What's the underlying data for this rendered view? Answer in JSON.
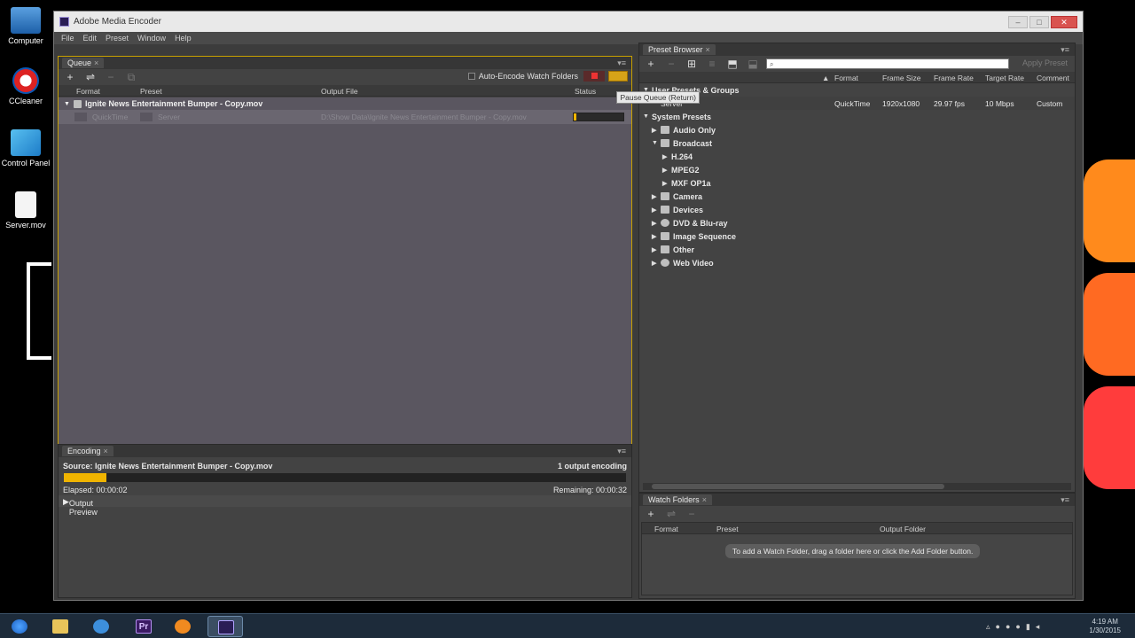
{
  "desktop": {
    "icons": [
      {
        "label": "Computer"
      },
      {
        "label": "CCleaner"
      },
      {
        "label": "Control Panel"
      },
      {
        "label": "Server.mov"
      }
    ]
  },
  "window": {
    "title": "Adobe Media Encoder",
    "controls": {
      "minimize": "–",
      "maximize": "□",
      "close": "✕"
    }
  },
  "menu": [
    "File",
    "Edit",
    "Preset",
    "Window",
    "Help"
  ],
  "queue": {
    "tab": "Queue",
    "auto_encode_label": "Auto-Encode Watch Folders",
    "tooltip": "Pause Queue (Return)",
    "columns": {
      "format": "Format",
      "preset": "Preset",
      "output": "Output File",
      "status": "Status"
    },
    "group_title": "Ignite News Entertainment Bumper - Copy.mov",
    "item": {
      "format": "QuickTime",
      "preset": "Server",
      "output": "D:\\Show Data\\Ignite News Entertainment Bumper - Copy.mov",
      "progress": 0.05
    }
  },
  "encoding": {
    "tab": "Encoding",
    "source": "Source: Ignite News Entertainment Bumper - Copy.mov",
    "count": "1 output encoding",
    "elapsed": "Elapsed: 00:00:02",
    "remaining": "Remaining: 00:00:32",
    "progress": 0.075,
    "output_preview": "Output Preview"
  },
  "presets": {
    "tab": "Preset Browser",
    "apply": "Apply Preset",
    "columns": {
      "format": "Format",
      "frame_size": "Frame Size",
      "frame_rate": "Frame Rate",
      "target_rate": "Target Rate",
      "comment": "Comment"
    },
    "user_group": "User Presets & Groups",
    "server": {
      "name": "Server",
      "format": "QuickTime",
      "frame_size": "1920x1080",
      "frame_rate": "29.97 fps",
      "target_rate": "10 Mbps",
      "comment": "Custom"
    },
    "system_group": "System Presets",
    "tree": [
      {
        "label": "Audio Only"
      },
      {
        "label": "Broadcast"
      },
      {
        "label": "H.264"
      },
      {
        "label": "MPEG2"
      },
      {
        "label": "MXF OP1a"
      },
      {
        "label": "Camera"
      },
      {
        "label": "Devices"
      },
      {
        "label": "DVD & Blu-ray"
      },
      {
        "label": "Image Sequence"
      },
      {
        "label": "Other"
      },
      {
        "label": "Web Video"
      }
    ]
  },
  "watch": {
    "tab": "Watch Folders",
    "columns": {
      "format": "Format",
      "preset": "Preset",
      "output": "Output Folder"
    },
    "hint": "To add a Watch Folder, drag a folder here or click the Add Folder button."
  },
  "taskbar": {
    "premiere": "Pr",
    "time": "4:19 AM",
    "date": "1/30/2015"
  }
}
